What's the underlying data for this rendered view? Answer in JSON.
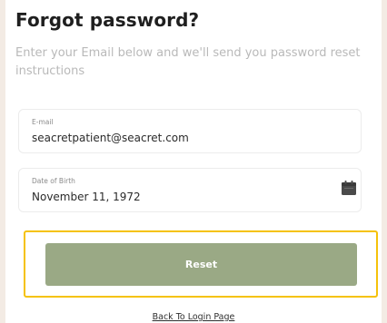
{
  "header": {
    "title": "Forgot password?",
    "subtitle": "Enter your Email below and we'll send you password reset instructions"
  },
  "form": {
    "email": {
      "label": "E-mail",
      "value": "seacretpatient@seacret.com"
    },
    "dob": {
      "label": "Date of Birth",
      "value": "November 11, 1972",
      "icon": "calendar-icon"
    },
    "reset_label": "Reset",
    "back_link_label": "Back To Login Page"
  },
  "colors": {
    "background": "#f3ebe4",
    "button": "#9aa985",
    "highlight": "#f5c20a"
  }
}
